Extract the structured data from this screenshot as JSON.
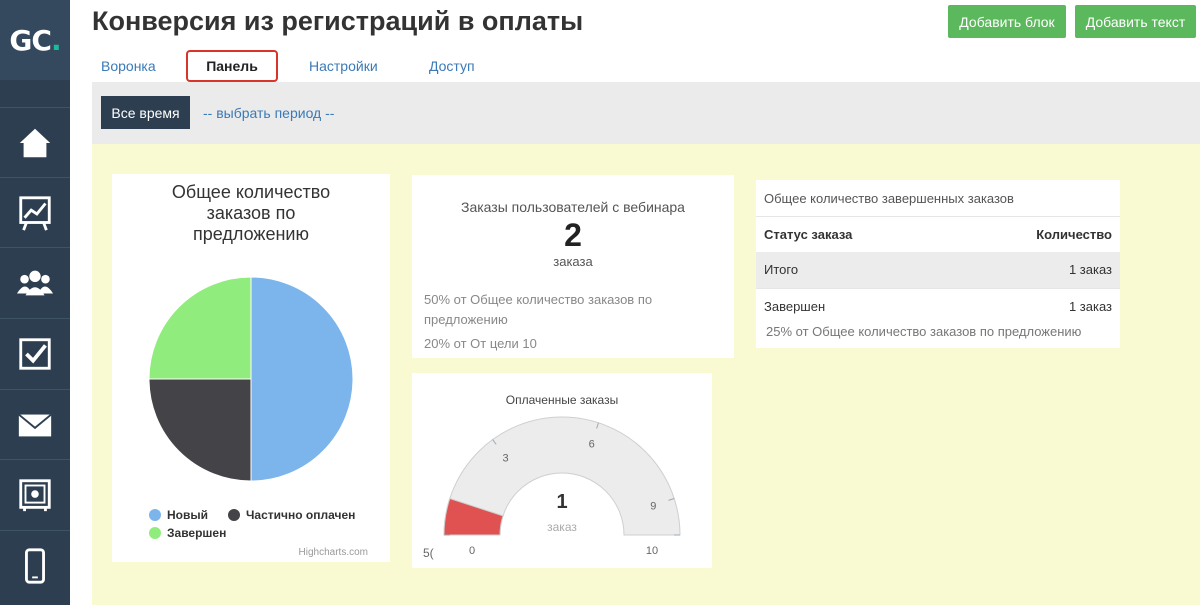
{
  "logo": {
    "text": "GC",
    "dot": "."
  },
  "page": {
    "title": "Конверсия из регистраций в оплаты"
  },
  "header": {
    "add_block": "Добавить блок",
    "add_text": "Добавить текст"
  },
  "tabs": {
    "funnel": "Воронка",
    "panel": "Панель",
    "settings": "Настройки",
    "access": "Доступ"
  },
  "filter": {
    "all_time": "Все время",
    "choose_period": "-- выбрать период --"
  },
  "sidebar": {
    "icons": [
      "home-icon",
      "chart-icon",
      "users-icon",
      "checkbox-icon",
      "mail-icon",
      "safe-icon",
      "mobile-icon"
    ]
  },
  "pie_card": {
    "title_line1": "Общее количество",
    "title_line2": "заказов по",
    "title_line3": "предложению",
    "credits": "Highcharts.com"
  },
  "webinar_card": {
    "title": "Заказы пользователей с вебинара",
    "count": "2",
    "unit": "заказа",
    "line1": "50% от Общее количество заказов по",
    "line1b": "предложению",
    "line2": "20% от От цели 10"
  },
  "gauge_card": {
    "title": "Оплаченные заказы",
    "value": "1",
    "unit": "заказ",
    "stub": "5("
  },
  "table_card": {
    "title": "Общее количество завершенных заказов",
    "col_status": "Статус заказа",
    "col_count": "Количество",
    "rows": [
      {
        "status": "Итого",
        "count": "1 заказ"
      },
      {
        "status": "Завершен",
        "count": "1 заказ"
      }
    ],
    "note": "25% от Общее количество заказов по предложению"
  },
  "chart_data": [
    {
      "type": "pie",
      "title": "Общее количество заказов по предложению",
      "series": [
        {
          "name": "Новый",
          "value": 50,
          "color": "#7cb5ec"
        },
        {
          "name": "Частично оплачен",
          "value": 25,
          "color": "#434348"
        },
        {
          "name": "Завершен",
          "value": 25,
          "color": "#90ed7d"
        }
      ],
      "legend": "bottom"
    },
    {
      "type": "gauge",
      "title": "Оплаченные заказы",
      "min": 0,
      "max": 10,
      "value": 1,
      "ticks": [
        "0",
        "3",
        "6",
        "9",
        "10"
      ],
      "band_color": "#e05252"
    }
  ]
}
